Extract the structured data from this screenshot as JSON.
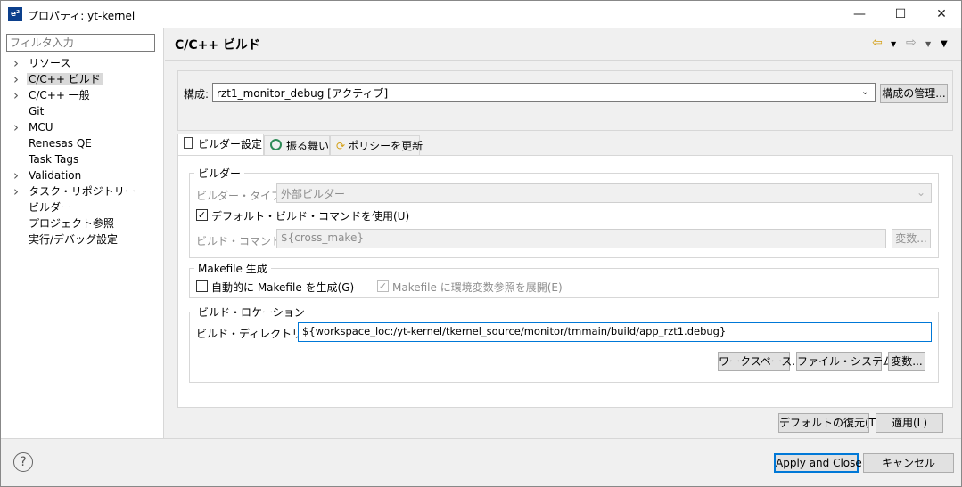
{
  "window": {
    "app_icon": "e²",
    "title": "プロパティ: yt-kernel",
    "minimize": "—",
    "maximize": "☐",
    "close": "✕"
  },
  "filter": {
    "placeholder": "フィルタ入力"
  },
  "tree": [
    {
      "label": "リソース",
      "expandable": true
    },
    {
      "label": "C/C++ ビルド",
      "expandable": true,
      "selected": true
    },
    {
      "label": "C/C++ 一般",
      "expandable": true
    },
    {
      "label": "Git",
      "expandable": false
    },
    {
      "label": "MCU",
      "expandable": true
    },
    {
      "label": "Renesas QE",
      "expandable": false
    },
    {
      "label": "Task Tags",
      "expandable": false
    },
    {
      "label": "Validation",
      "expandable": true
    },
    {
      "label": "タスク・リポジトリー",
      "expandable": true
    },
    {
      "label": "ビルダー",
      "expandable": false
    },
    {
      "label": "プロジェクト参照",
      "expandable": false
    },
    {
      "label": "実行/デバッグ設定",
      "expandable": false
    }
  ],
  "page": {
    "title": "C/C++ ビルド",
    "nav_back": "⇦",
    "nav_forward": "⇨",
    "menu": "▼"
  },
  "config": {
    "label": "構成:",
    "value": "rzt1_monitor_debug  [アクティブ]",
    "manage_button": "構成の管理..."
  },
  "tabs": [
    {
      "label": "ビルダー設定",
      "icon": "builder-settings-icon",
      "active": true
    },
    {
      "label": "振る舞い",
      "icon": "behavior-icon",
      "active": false
    },
    {
      "label": "ポリシーを更新",
      "icon": "refresh-policy-icon",
      "active": false
    }
  ],
  "builder": {
    "group_label": "ビルダー",
    "type_label": "ビルダー・タイプ(T):",
    "type_value": "外部ビルダー",
    "use_default_label": "デフォルト・ビルド・コマンドを使用(U)",
    "use_default_checked": true,
    "command_label": "ビルド・コマンド(C):",
    "command_value": "${cross_make}",
    "variables_button": "変数..."
  },
  "makefile": {
    "group_label": "Makefile 生成",
    "auto_generate_label": "自動的に Makefile を生成(G)",
    "auto_generate_checked": false,
    "expand_env_label": "Makefile に環境変数参照を展開(E)",
    "expand_env_checked": true
  },
  "location": {
    "group_label": "ビルド・ロケーション",
    "dir_label": "ビルド・ディレクトリー(D):",
    "dir_value": "${workspace_loc:/yt-kernel/tkernel_source/monitor/tmmain/build/app_rzt1.debug}",
    "workspace_button": "ワークスペース...",
    "filesystem_button": "ファイル・システム...",
    "variables_button": "変数..."
  },
  "page_buttons": {
    "restore_defaults": "デフォルトの復元(T)",
    "apply": "適用(L)"
  },
  "footer": {
    "help": "?",
    "apply_close": "Apply and Close",
    "cancel": "キャンセル"
  }
}
